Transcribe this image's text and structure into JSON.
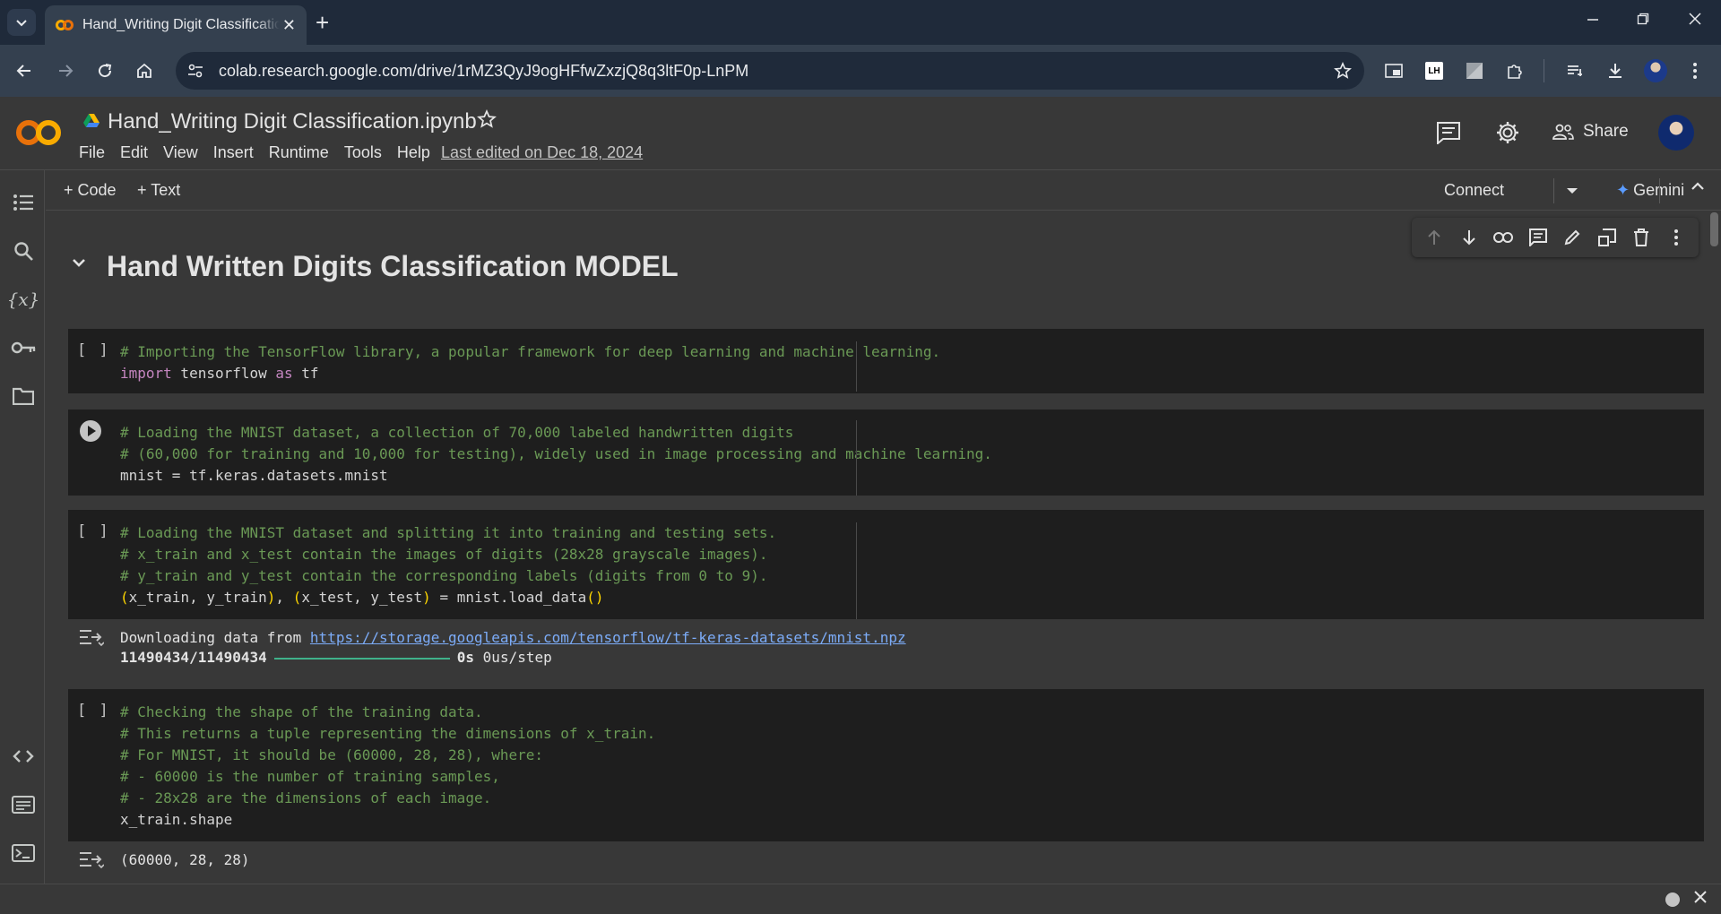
{
  "browser": {
    "tab_title": "Hand_Writing Digit Classificatio",
    "tab_close": "✕",
    "new_tab": "+",
    "url": "colab.research.google.com/drive/1rMZ3QyJ9ogHFfwZxzjQ8q3ltF0p-LnPM",
    "extensions": [
      "picture-in-picture-icon",
      "lighthouse-icon",
      "extension-icon",
      "puzzle-icon"
    ],
    "lh_label": "LH"
  },
  "colab": {
    "notebook_title": "Hand_Writing Digit Classification.ipynb",
    "menu": [
      "File",
      "Edit",
      "View",
      "Insert",
      "Runtime",
      "Tools",
      "Help"
    ],
    "last_edited": "Last edited on Dec 18, 2024",
    "share_label": "Share"
  },
  "toolbar": {
    "add_code": "+ Code",
    "add_text": "+ Text",
    "connect": "Connect",
    "gemini": "Gemini",
    "gemini_spark": "✦"
  },
  "heading": "Hand Written Digits Classification MODEL",
  "cells": [
    {
      "lines": [
        "# Importing the TensorFlow library, a popular framework for deep learning and machine learning.",
        "import tensorflow as tf"
      ]
    },
    {
      "lines": [
        "# Loading the MNIST dataset, a collection of 70,000 labeled handwritten digits",
        "# (60,000 for training and 10,000 for testing), widely used in image processing and machine learning.",
        "mnist = tf.keras.datasets.mnist"
      ]
    },
    {
      "lines": [
        "# Loading the MNIST dataset and splitting it into training and testing sets.",
        "# x_train and x_test contain the images of digits (28x28 grayscale images).",
        "# y_train and y_test contain the corresponding labels (digits from 0 to 9).",
        "(x_train, y_train), (x_test, y_test) = mnist.load_data()"
      ],
      "output": {
        "prefix": "Downloading data from ",
        "link": "https://storage.googleapis.com/tensorflow/tf-keras-datasets/mnist.npz",
        "progress_count": "11490434/11490434",
        "progress_fraction": 1.0,
        "time": "0s",
        "rate": "0us/step"
      }
    },
    {
      "lines": [
        "# Checking the shape of the training data.",
        "# This returns a tuple representing the dimensions of x_train.",
        "# For MNIST, it should be (60000, 28, 28), where:",
        "# - 60000 is the number of training samples,",
        "# - 28x28 are the dimensions of each image.",
        "x_train.shape"
      ],
      "output": {
        "text": "(60000, 28, 28)"
      }
    }
  ],
  "cell_bracket": "[ ]",
  "colors": {
    "accent_orange": "#e8710a",
    "accent_yellow": "#f9ab00",
    "comment_green": "#6a9955",
    "keyword_pink": "#c586c0",
    "link_blue": "#7cacf8",
    "progress_green": "#3fb28a"
  }
}
